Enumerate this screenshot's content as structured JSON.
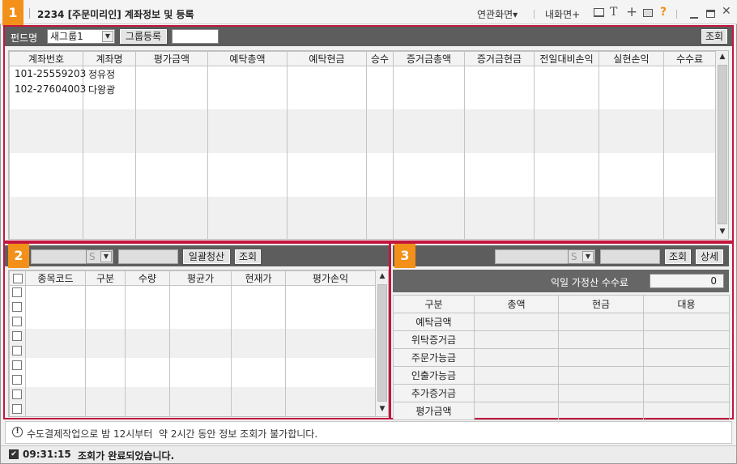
{
  "window": {
    "number": "1",
    "title": "2234 [주문미리인] 계좌정보 및 등록",
    "menus": [
      "연관화면▾",
      "내화면+"
    ],
    "icons": [
      "screen-icon",
      "text-icon",
      "plus-icon",
      "print-icon",
      "help-icon",
      "minimize-icon",
      "maximize-icon",
      "close-icon"
    ],
    "icon_glyphs": {
      "text": "T",
      "plus": "+",
      "help": "?",
      "close": "✕"
    },
    "help_color": "#f39019"
  },
  "panel1": {
    "number": "1",
    "fund_label": "펀드명",
    "group_value": "새그룹1",
    "group_register": "그룹등록",
    "query": "조회",
    "columns": [
      "계좌번호",
      "계좌명",
      "평가금액",
      "예탁총액",
      "예탁현금",
      "승수",
      "증거금총액",
      "증거금현금",
      "전일대비손익",
      "실현손익",
      "수수료"
    ],
    "rows": [
      {
        "account": "101-25559203",
        "name": "정유정"
      },
      {
        "account": "102-27604003",
        "name": "다왕광"
      }
    ]
  },
  "panel2": {
    "number": "2",
    "select_value": "S",
    "bulk_settle": "일괄청산",
    "query": "조회",
    "columns": [
      "종목코드",
      "구분",
      "수량",
      "평균가",
      "현재가",
      "평가손익"
    ]
  },
  "panel3": {
    "number": "3",
    "select_value": "S",
    "query": "조회",
    "detail": "상세",
    "fee_label": "익일 가정산 수수료",
    "fee_value": "0",
    "columns": [
      "구분",
      "총액",
      "현금",
      "대용"
    ],
    "rows": [
      "예탁금액",
      "위탁증거금",
      "주문가능금",
      "인출가능금",
      "추가증거금",
      "평가금액"
    ]
  },
  "notice": {
    "icon": "!",
    "text": "수도결제작업으로 밤 12시부터  약 2시간 동안 정보 조회가 불가합니다."
  },
  "status": {
    "time": "09:31:15",
    "message": "조회가 완료되었습니다."
  },
  "colors": {
    "accent": "#f39019",
    "frame": "#c2163e",
    "toolbar": "#5d5d5d"
  }
}
